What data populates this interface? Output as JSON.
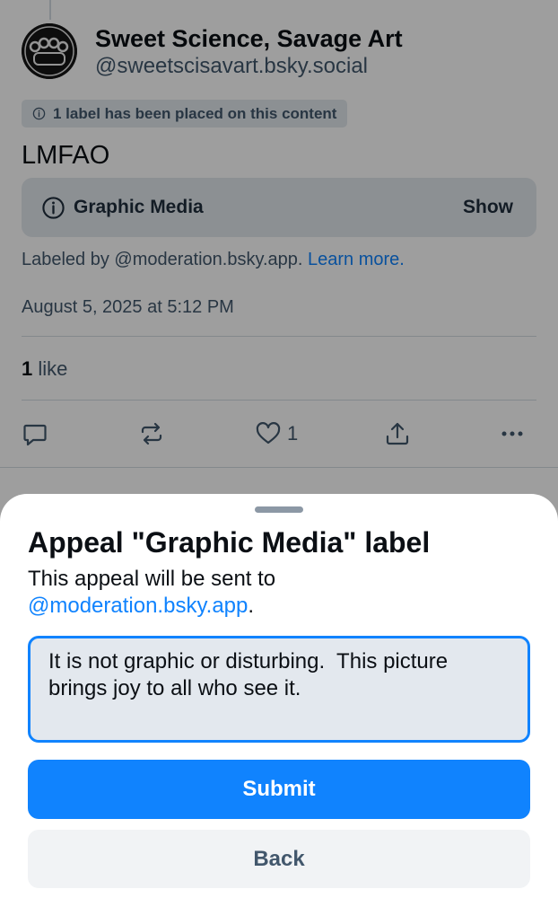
{
  "post": {
    "author_name": "Sweet Science, Savage Art",
    "author_handle": "@sweetscisavart.bsky.social",
    "label_notice": "1 label has been placed on this content",
    "text": "LMFAO",
    "media_warning": {
      "title": "Graphic Media",
      "show_label": "Show"
    },
    "labeled_by_prefix": "Labeled by @moderation.bsky.app. ",
    "learn_more": "Learn more.",
    "timestamp": "August 5, 2025 at 5:12 PM",
    "like_count": "1",
    "like_word": " like",
    "action_like_count": "1"
  },
  "sheet": {
    "title": "Appeal \"Graphic Media\" label",
    "desc_prefix": "This appeal will be sent to ",
    "desc_link": "@moderation.bsky.app",
    "desc_suffix": ".",
    "input_value": "It is not graphic or disturbing.  This picture brings joy to all who see it.",
    "submit_label": "Submit",
    "back_label": "Back"
  },
  "colors": {
    "accent": "#1083fe",
    "muted_text": "#42576c",
    "pill_bg": "#e3e8ee"
  },
  "icons": [
    "info-icon",
    "reply-icon",
    "repost-icon",
    "heart-icon",
    "share-icon",
    "more-icon"
  ]
}
